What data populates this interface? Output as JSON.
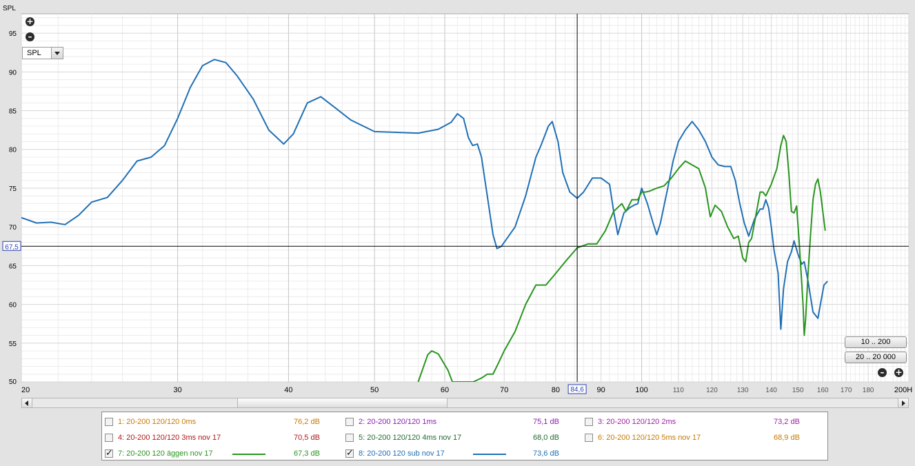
{
  "chart_data": {
    "type": "line",
    "title": "",
    "ylabel": "SPL",
    "xlabel": "",
    "x_scale": "log",
    "xlim": [
      20,
      200
    ],
    "ylim": [
      50,
      97.5
    ],
    "grid": true,
    "x_ticks": [
      {
        "v": 20,
        "label": "20"
      },
      {
        "v": 30,
        "label": "30"
      },
      {
        "v": 40,
        "label": "40"
      },
      {
        "v": 50,
        "label": "50"
      },
      {
        "v": 60,
        "label": "60"
      },
      {
        "v": 70,
        "label": "70"
      },
      {
        "v": 80,
        "label": "80"
      },
      {
        "v": 90,
        "label": "90"
      },
      {
        "v": 100,
        "label": "100"
      },
      {
        "v": 110,
        "label": "110"
      },
      {
        "v": 120,
        "label": "120"
      },
      {
        "v": 130,
        "label": "130"
      },
      {
        "v": 140,
        "label": "140"
      },
      {
        "v": 150,
        "label": "150"
      },
      {
        "v": 160,
        "label": "160"
      },
      {
        "v": 170,
        "label": "170"
      },
      {
        "v": 180,
        "label": "180"
      },
      {
        "v": 200,
        "label": "200H"
      }
    ],
    "y_ticks": [
      95,
      90,
      85,
      80,
      75,
      70,
      65,
      60,
      55,
      50
    ],
    "cursor": {
      "x": 84.6,
      "x_label": "84,6",
      "y": 67.5,
      "y_label": "67,5"
    },
    "series": [
      {
        "name": "8: 20-200 120 sub nov 17",
        "color": "#1f6fb4",
        "points": [
          [
            20,
            71.2
          ],
          [
            20.8,
            70.5
          ],
          [
            21.6,
            70.6
          ],
          [
            22.4,
            70.3
          ],
          [
            23.2,
            71.5
          ],
          [
            24,
            73.2
          ],
          [
            25,
            73.8
          ],
          [
            26,
            76
          ],
          [
            27,
            78.5
          ],
          [
            28,
            79
          ],
          [
            29,
            80.5
          ],
          [
            30,
            84
          ],
          [
            31,
            88
          ],
          [
            32,
            90.8
          ],
          [
            33,
            91.6
          ],
          [
            34,
            91.2
          ],
          [
            35,
            89.5
          ],
          [
            36.5,
            86.5
          ],
          [
            38,
            82.5
          ],
          [
            39.5,
            80.7
          ],
          [
            40.5,
            82
          ],
          [
            42,
            86
          ],
          [
            43.5,
            86.8
          ],
          [
            45,
            85.5
          ],
          [
            47,
            83.8
          ],
          [
            50,
            82.3
          ],
          [
            53,
            82.2
          ],
          [
            56,
            82.1
          ],
          [
            59,
            82.6
          ],
          [
            61,
            83.5
          ],
          [
            62,
            84.6
          ],
          [
            63,
            84
          ],
          [
            63.8,
            81.5
          ],
          [
            64.5,
            80.5
          ],
          [
            65.3,
            80.7
          ],
          [
            66,
            79
          ],
          [
            67,
            74
          ],
          [
            68,
            69
          ],
          [
            68.7,
            67.2
          ],
          [
            69.5,
            67.5
          ],
          [
            71,
            69
          ],
          [
            72,
            70
          ],
          [
            74,
            74
          ],
          [
            76,
            79
          ],
          [
            77,
            80.5
          ],
          [
            78.5,
            83
          ],
          [
            79.3,
            83.6
          ],
          [
            80.5,
            81
          ],
          [
            81.5,
            77
          ],
          [
            83,
            74.5
          ],
          [
            84.6,
            73.7
          ],
          [
            86,
            74.5
          ],
          [
            88,
            76.3
          ],
          [
            90,
            76.3
          ],
          [
            92,
            75.5
          ],
          [
            93,
            72
          ],
          [
            94,
            69
          ],
          [
            95.5,
            71.8
          ],
          [
            97,
            72.5
          ],
          [
            98,
            72.8
          ],
          [
            99,
            73
          ],
          [
            100,
            75
          ],
          [
            101.5,
            73
          ],
          [
            103,
            70.5
          ],
          [
            104,
            69
          ],
          [
            105,
            70.5
          ],
          [
            107,
            75
          ],
          [
            108.5,
            78.5
          ],
          [
            110,
            81
          ],
          [
            112,
            82.5
          ],
          [
            114,
            83.6
          ],
          [
            116,
            82.5
          ],
          [
            118,
            81
          ],
          [
            120,
            79
          ],
          [
            122,
            78
          ],
          [
            124,
            77.8
          ],
          [
            126,
            77.8
          ],
          [
            127.5,
            76
          ],
          [
            129,
            73
          ],
          [
            130.5,
            70.5
          ],
          [
            132,
            68.8
          ],
          [
            134,
            71
          ],
          [
            136,
            72.3
          ],
          [
            137,
            72.3
          ],
          [
            138,
            73.5
          ],
          [
            139,
            72.5
          ],
          [
            140,
            70
          ],
          [
            141,
            67
          ],
          [
            142.5,
            64
          ],
          [
            143.5,
            56.8
          ],
          [
            144.5,
            62
          ],
          [
            146,
            65.5
          ],
          [
            147.5,
            66.8
          ],
          [
            148.5,
            68.2
          ],
          [
            150,
            66.5
          ],
          [
            151.5,
            65.2
          ],
          [
            152.5,
            65.5
          ],
          [
            154,
            63
          ],
          [
            156,
            59
          ],
          [
            158,
            58.2
          ],
          [
            159,
            60
          ],
          [
            160.5,
            62.5
          ],
          [
            162,
            63
          ]
        ]
      },
      {
        "name": "7: 20-200 120 äggen nov 17",
        "color": "#28941e",
        "points": [
          [
            56,
            50
          ],
          [
            57.4,
            53.5
          ],
          [
            58,
            54
          ],
          [
            59,
            53.6
          ],
          [
            60.5,
            51.5
          ],
          [
            61.2,
            50
          ],
          [
            64.6,
            50
          ],
          [
            66,
            50.5
          ],
          [
            67,
            51
          ],
          [
            68,
            51
          ],
          [
            69,
            52.5
          ],
          [
            70,
            54
          ],
          [
            72,
            56.5
          ],
          [
            74,
            60
          ],
          [
            76,
            62.5
          ],
          [
            78,
            62.5
          ],
          [
            80,
            64
          ],
          [
            82,
            65.5
          ],
          [
            84.6,
            67.3
          ],
          [
            87,
            67.8
          ],
          [
            89,
            67.8
          ],
          [
            91,
            69.5
          ],
          [
            93,
            72
          ],
          [
            95,
            73
          ],
          [
            96,
            72
          ],
          [
            97.5,
            73.5
          ],
          [
            99,
            73.5
          ],
          [
            100,
            74.5
          ],
          [
            101,
            74.5
          ],
          [
            102,
            74.6
          ],
          [
            104,
            75
          ],
          [
            106,
            75.3
          ],
          [
            108,
            76.3
          ],
          [
            110,
            77.5
          ],
          [
            112,
            78.5
          ],
          [
            114,
            78
          ],
          [
            116,
            77.5
          ],
          [
            118,
            75
          ],
          [
            119.5,
            71.3
          ],
          [
            121,
            72.8
          ],
          [
            123,
            72
          ],
          [
            125,
            70
          ],
          [
            127,
            68.5
          ],
          [
            128.5,
            68.8
          ],
          [
            130,
            66
          ],
          [
            131,
            65.5
          ],
          [
            132,
            68
          ],
          [
            133,
            68.5
          ],
          [
            134,
            70.5
          ],
          [
            136,
            74.5
          ],
          [
            137,
            74.5
          ],
          [
            138,
            74
          ],
          [
            140,
            75.5
          ],
          [
            142,
            77.5
          ],
          [
            143.5,
            80.5
          ],
          [
            144.5,
            81.8
          ],
          [
            145.5,
            81
          ],
          [
            146.5,
            77
          ],
          [
            147.5,
            72
          ],
          [
            148.5,
            71.8
          ],
          [
            149.5,
            72.7
          ],
          [
            150.5,
            68
          ],
          [
            152,
            60
          ],
          [
            152.5,
            56
          ],
          [
            153,
            58
          ],
          [
            154,
            64
          ],
          [
            155,
            69
          ],
          [
            156,
            73.5
          ],
          [
            157,
            75.5
          ],
          [
            158,
            76.2
          ],
          [
            159,
            74.5
          ],
          [
            160,
            72
          ],
          [
            161,
            69.5
          ]
        ]
      }
    ]
  },
  "controls": {
    "zoom_in_icon": "plus-circle-icon",
    "zoom_out_icon": "minus-circle-icon",
    "spl_select": "SPL",
    "range_btn_1": "10 .. 200",
    "range_btn_2": "20 .. 20 000"
  },
  "legend": [
    {
      "label": "1: 20-200 120/120 0ms",
      "value": "76,2 dB",
      "color": "#c87800",
      "checked": false
    },
    {
      "label": "2: 20-200 120/120 1ms",
      "value": "75,1 dB",
      "color": "#8a1db0",
      "checked": false
    },
    {
      "label": "3: 20-200 120/120 2ms",
      "value": "73,2 dB",
      "color": "#9e20a0",
      "checked": false
    },
    {
      "label": "4: 20-200 120/120 3ms nov 17",
      "value": "70,5 dB",
      "color": "#b01818",
      "checked": false
    },
    {
      "label": "5: 20-200 120/120 4ms nov 17",
      "value": "68,0 dB",
      "color": "#1f6d2f",
      "checked": false
    },
    {
      "label": "6: 20-200 120/120 5ms nov 17",
      "value": "68,9 dB",
      "color": "#c87800",
      "checked": false
    },
    {
      "label": "7: 20-200 120 äggen nov 17",
      "value": "67,3 dB",
      "color": "#28941e",
      "checked": true
    },
    {
      "label": "8: 20-200 120 sub nov 17",
      "value": "73,6 dB",
      "color": "#1f6fb4",
      "checked": true
    }
  ]
}
